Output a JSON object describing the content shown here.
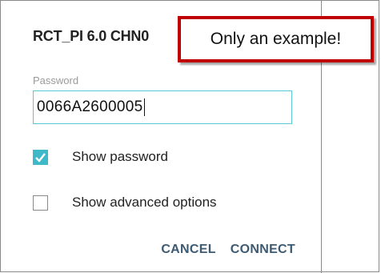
{
  "dialog": {
    "network_title": "RCT_PI 6.0 CHN0",
    "password_label": "Password",
    "password_value": "0066A2600005",
    "show_password_label": "Show password",
    "show_password_checked": true,
    "show_advanced_label": "Show advanced options",
    "show_advanced_checked": false,
    "cancel_label": "CANCEL",
    "connect_label": "CONNECT"
  },
  "callout": {
    "text": "Only an example!"
  },
  "colors": {
    "accent": "#3db9c8",
    "field_border": "#5cc8d2",
    "button_text": "#3d5a73",
    "callout_border": "#c00000"
  },
  "icons": {
    "checkbox_checked": "check-icon"
  }
}
